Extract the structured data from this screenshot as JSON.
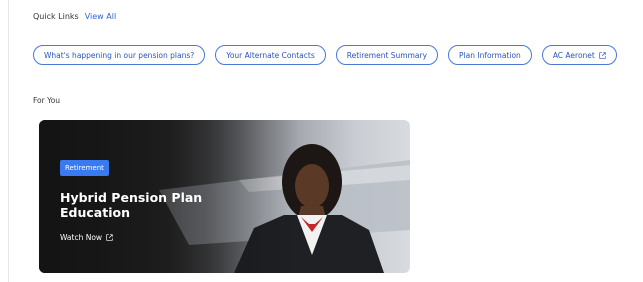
{
  "quick_links": {
    "title": "Quick Links",
    "view_all": "View All",
    "items": [
      {
        "label": "What's happening in our pension plans?",
        "external": false
      },
      {
        "label": "Your Alternate Contacts",
        "external": false
      },
      {
        "label": "Retirement Summary",
        "external": false
      },
      {
        "label": "Plan Information",
        "external": false
      },
      {
        "label": "AC Aeronet",
        "external": true
      }
    ]
  },
  "for_you": {
    "title": "For You",
    "card": {
      "badge": "Retirement",
      "title": "Hybrid Pension Plan Education",
      "link": "Watch Now"
    }
  },
  "colors": {
    "accent": "#2f64d6",
    "badge": "#3a7af0"
  }
}
